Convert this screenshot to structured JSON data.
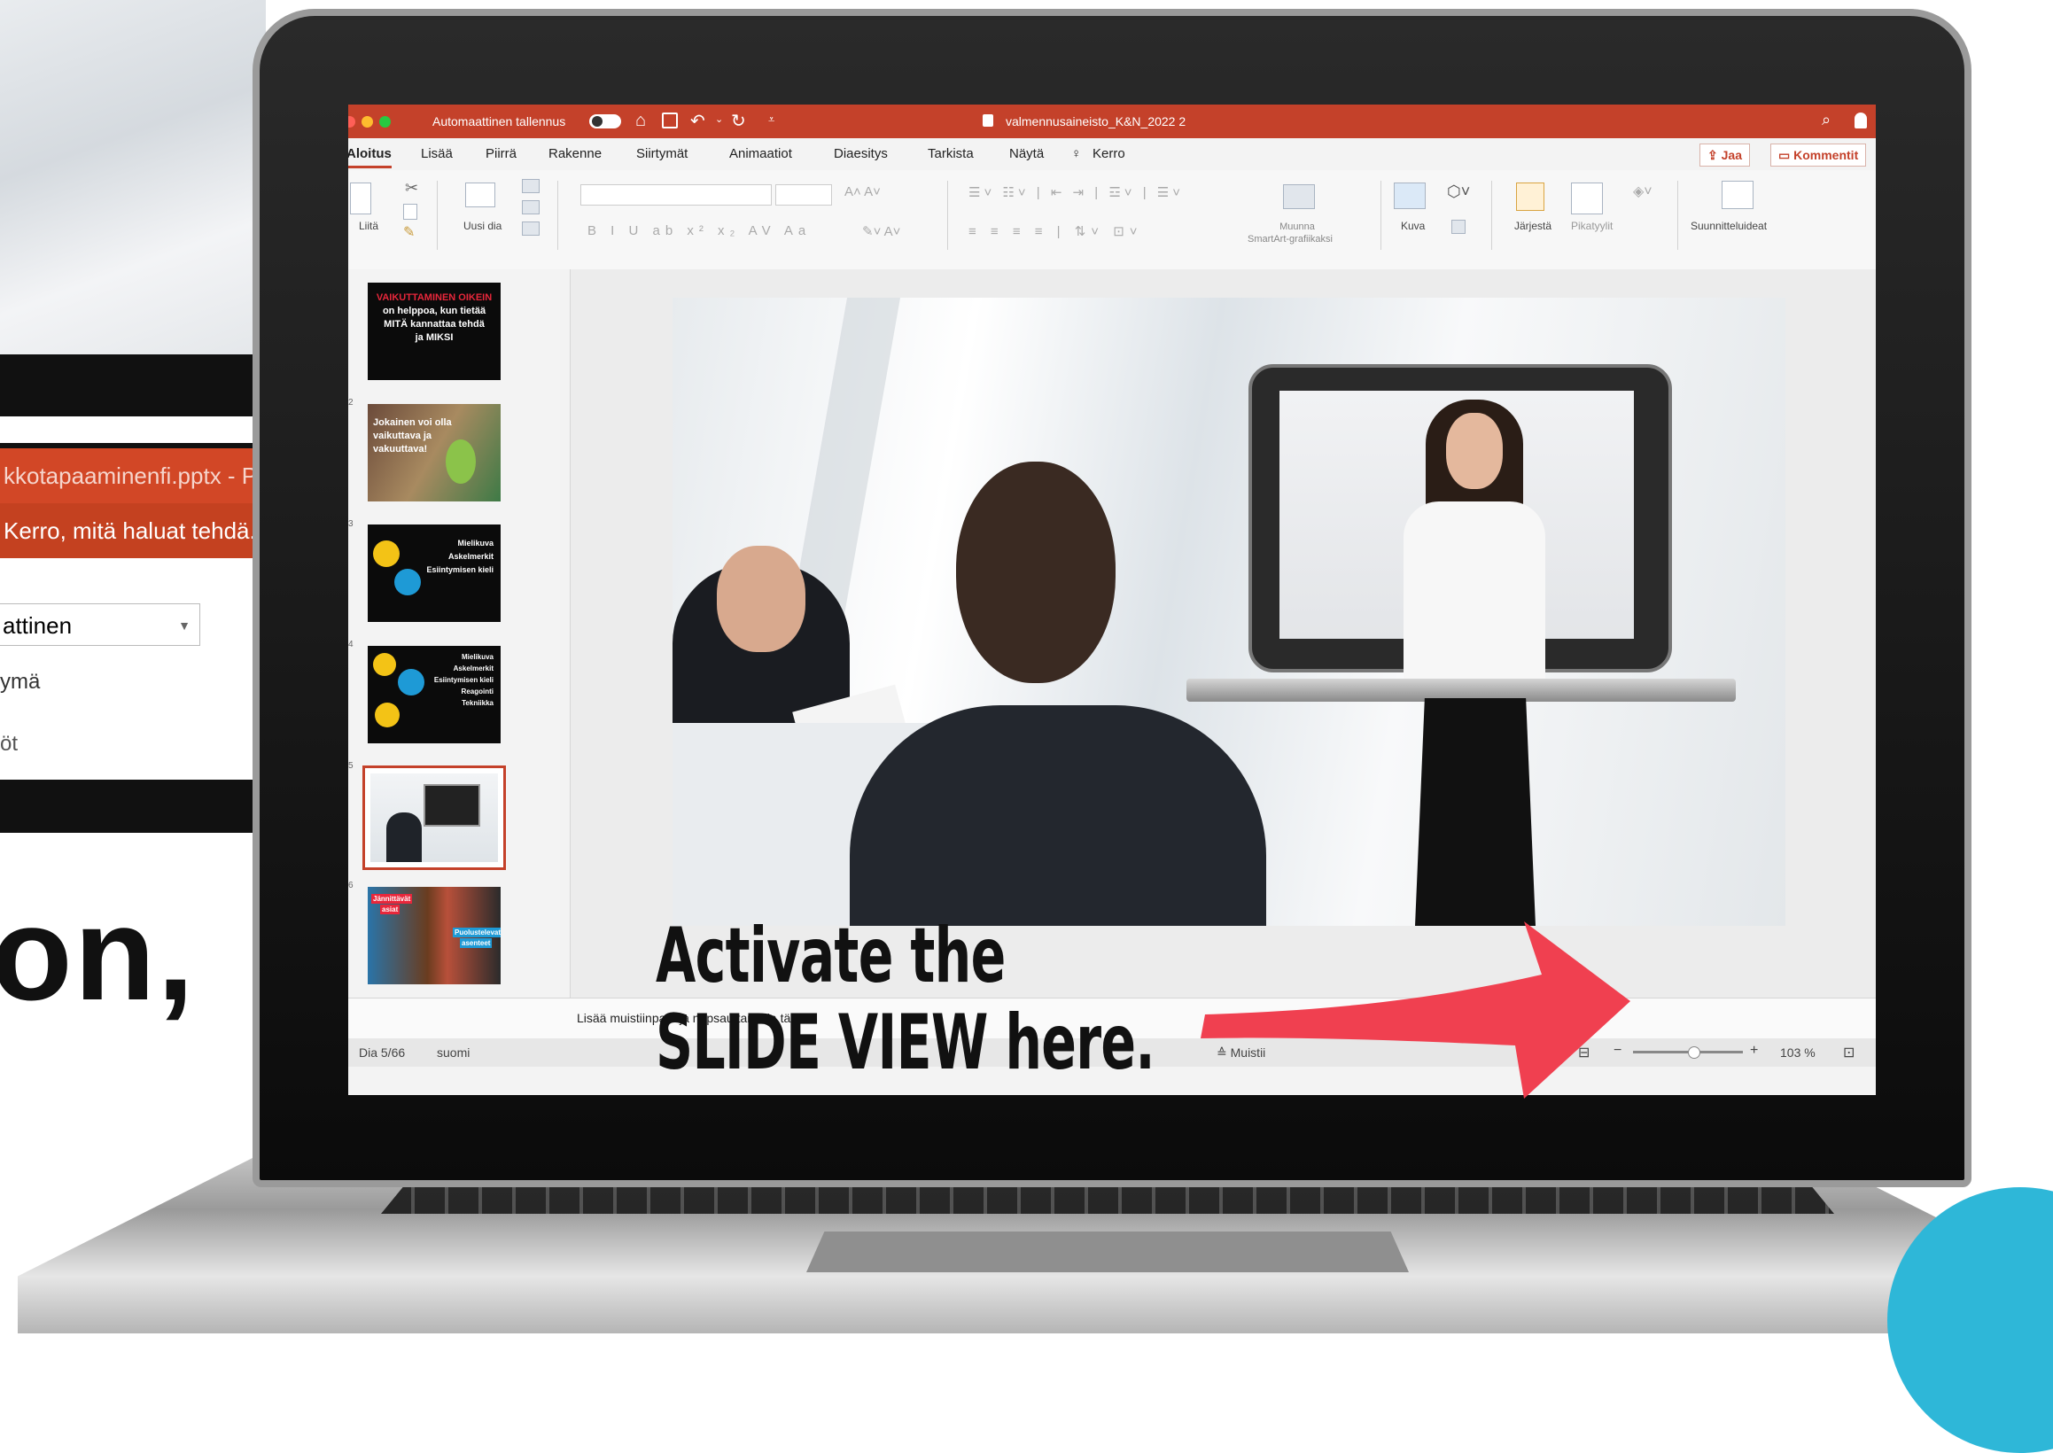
{
  "background": {
    "filename_fragment": "kkotapaaminenfi.pptx - P",
    "tell_me_text": "Kerro, mitä haluat tehdä.",
    "select_value": "attinen",
    "item1": "ymä",
    "item2": "öt",
    "big_text": "on,"
  },
  "titlebar": {
    "autosave_label": "Automaattinen tallennus",
    "doc_title": "valmennusaineisto_K&N_2022 2"
  },
  "tabs": [
    "Aloitus",
    "Lisää",
    "Piirrä",
    "Rakenne",
    "Siirtymät",
    "Animaatiot",
    "Diaesitys",
    "Tarkista",
    "Näytä",
    "Kerro"
  ],
  "share": {
    "jaa": "Jaa",
    "kommentit": "Kommentit"
  },
  "ribbon": {
    "paste": "Liitä",
    "new_slide": "Uusi dia",
    "smartart_line1": "Muunna",
    "smartart_line2": "SmartArt-grafiikaksi",
    "picture": "Kuva",
    "arrange": "Järjestä",
    "quick_styles": "Pikatyylit",
    "designer": "Suunnitteluideat"
  },
  "thumbnails": [
    {
      "number": "",
      "lines": [
        "VAIKUTTAMINEN OIKEIN",
        "on helppoa, kun tietää",
        "MITÄ kannattaa tehdä",
        "ja MIKSI"
      ]
    },
    {
      "number": "2",
      "lines": [
        "Jokainen voi olla",
        "vaikuttava ja",
        "vakuuttava!"
      ]
    },
    {
      "number": "3",
      "lines": [
        "Mielikuva",
        "Askelmerkit",
        "Esiintymisen kieli"
      ]
    },
    {
      "number": "4",
      "lines": [
        "Mielikuva",
        "Askelmerkit",
        "Esiintymisen kieli",
        "Reagointi",
        "Tekniikka"
      ]
    },
    {
      "number": "5",
      "lines": []
    },
    {
      "number": "6",
      "lines": [
        "Jännittävät",
        "asiat",
        "Puolustelevat",
        "asenteet"
      ]
    }
  ],
  "notes_placeholder": "Lisää muistiinpanoja napsauttamalla tätä",
  "status": {
    "slide_info": "Dia 5/66",
    "language": "suomi",
    "notes": "Muistii",
    "zoom_percent": "103 %",
    "zoom_level": 0.55
  },
  "callout": {
    "line1": "Activate the",
    "line2": "SLIDE VIEW here."
  },
  "colors": {
    "office_red": "#c4412a",
    "arrow": "#f04050",
    "accent_blue": "#2eb7d8"
  },
  "icons": [
    "home-icon",
    "save-icon",
    "undo-icon",
    "redo-icon",
    "search-icon",
    "user-icon",
    "lightbulb-icon",
    "slide-view-icon",
    "fit-icon"
  ]
}
